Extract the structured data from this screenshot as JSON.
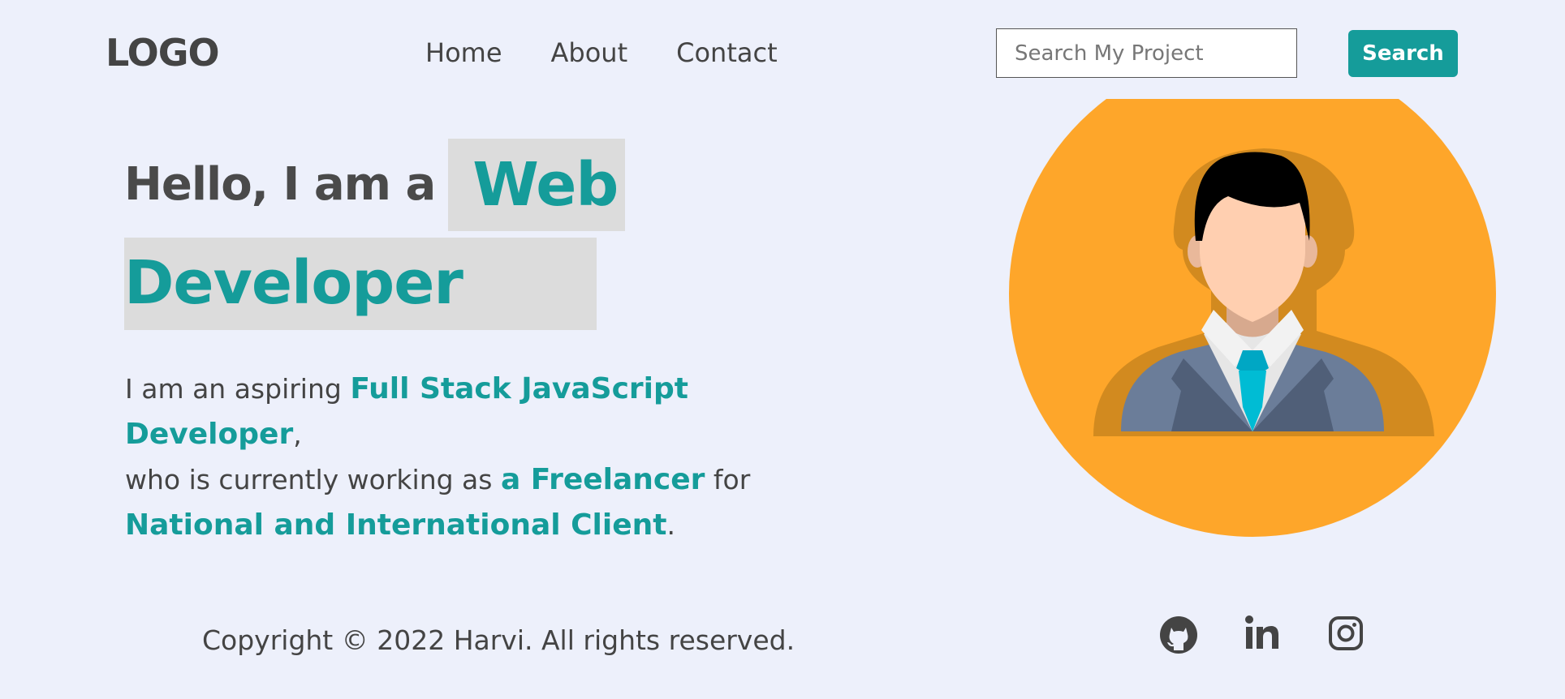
{
  "header": {
    "logo": "LOGO",
    "nav": [
      {
        "label": "Home"
      },
      {
        "label": "About"
      },
      {
        "label": "Contact"
      }
    ],
    "search": {
      "placeholder": "Search My Project",
      "button_label": "Search"
    }
  },
  "hero": {
    "greeting": "Hello, I am a",
    "role_word1": "Web",
    "role_word2": "Developer",
    "intro": {
      "part1": "I am an aspiring ",
      "highlight1": "Full Stack JavaScript Developer",
      "part2": ",",
      "part3": "who is currently working as ",
      "highlight2": "a Freelancer",
      "part4": " for",
      "highlight3": "National and International Client",
      "part5": "."
    }
  },
  "avatar": {
    "icon": "developer-avatar-illustration"
  },
  "footer": {
    "copyright": "Copyright © 2022 Harvi. All rights reserved.",
    "social": [
      {
        "icon": "github-icon"
      },
      {
        "icon": "linkedin-icon"
      },
      {
        "icon": "instagram-icon"
      }
    ]
  },
  "colors": {
    "background": "#edf0fb",
    "accent": "#159c9a",
    "text": "#444444",
    "highlight_bg": "#dcdcdc",
    "avatar_bg": "#fea62a"
  }
}
